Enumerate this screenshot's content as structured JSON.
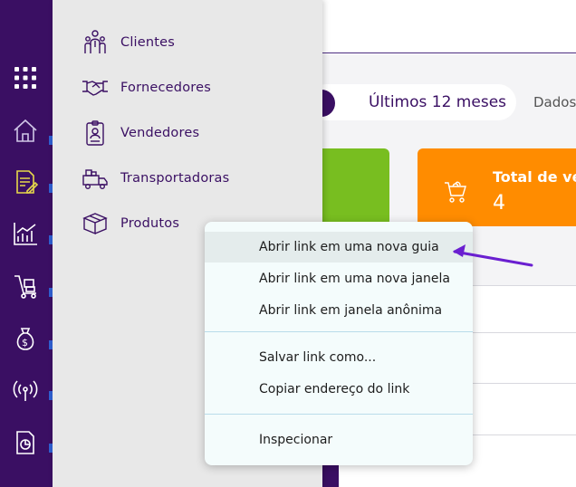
{
  "sidebar_menu": {
    "items": [
      {
        "label": "Clientes",
        "icon": "clients-icon"
      },
      {
        "label": "Fornecedores",
        "icon": "handshake-icon"
      },
      {
        "label": "Vendedores",
        "icon": "badge-icon"
      },
      {
        "label": "Transportadoras",
        "icon": "truck-icon"
      },
      {
        "label": "Produtos",
        "icon": "box-icon"
      }
    ]
  },
  "rail": {
    "icons": [
      "apps-grid-icon",
      "home-icon",
      "document-edit-icon",
      "chart-icon",
      "hand-truck-icon",
      "money-bag-icon",
      "broadcast-icon",
      "report-icon"
    ]
  },
  "background": {
    "period_label": "Últimos 12 meses",
    "dados_label": "Dados",
    "card_title": "Total de ven",
    "card_value": "4"
  },
  "context_menu": {
    "open_new_tab": "Abrir link em uma nova guia",
    "open_new_window": "Abrir link em uma nova janela",
    "open_incognito": "Abrir link em janela anônima",
    "save_link": "Salvar link como...",
    "copy_link": "Copiar endereço do link",
    "inspect": "Inspecionar"
  },
  "colors": {
    "brand_purple": "#3a0f63",
    "green": "#78be20",
    "orange": "#ff8c00",
    "arrow": "#6a1fd0"
  }
}
